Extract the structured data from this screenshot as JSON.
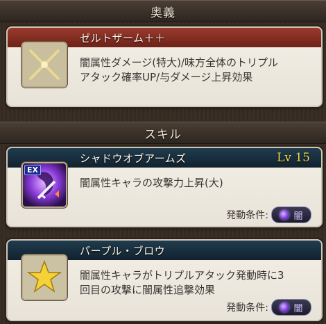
{
  "sections": {
    "ougi_title": "奥義",
    "skill_title": "スキル"
  },
  "ougi": {
    "name": "ゼルトザーム＋＋",
    "desc_line1": "闇属性ダメージ(特大)/味方全体のトリプル",
    "desc_line2": "アタック確率UP/与ダメージ上昇効果",
    "icon": "crossed-swords-icon"
  },
  "skills": [
    {
      "name": "シャドウオブアームズ",
      "level": "Lv 15",
      "desc_line1": "闇属性キャラの攻撃力上昇(大)",
      "desc_line2": "",
      "cond_label": "発動条件:",
      "cond_value": "闇",
      "badge": "EX",
      "icon": "shadow-arms-icon"
    },
    {
      "name": "パープル・ブロウ",
      "level": "",
      "desc_line1": "闇属性キャラがトリプルアタック発動時に3",
      "desc_line2": "回目の攻撃に闇属性追撃効果",
      "cond_label": "発動条件:",
      "cond_value": "闇",
      "icon": "star-icon"
    }
  ],
  "colors": {
    "ougi_header": "#9a3a2e",
    "skill_header": "#1a3344",
    "level_text": "#f2d64a",
    "dark_element": "#7b3dd8"
  }
}
